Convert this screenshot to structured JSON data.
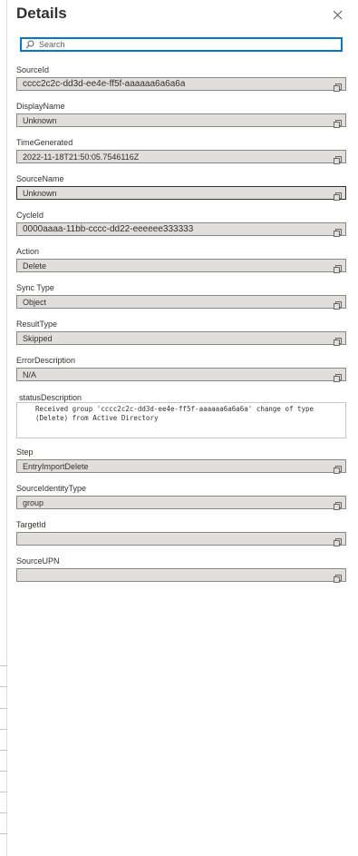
{
  "panel": {
    "title": "Details",
    "close_icon": "close-icon"
  },
  "search": {
    "placeholder": "Search",
    "icon": "search-icon"
  },
  "fields": [
    {
      "label": "SourceId",
      "value": "cccc2c2c-dd3d-ee4e-ff5f-aaaaaa6a6a6a"
    },
    {
      "label": "DisplayName",
      "value": "Unknown"
    },
    {
      "label": "TimeGenerated",
      "value": "2022-11-18T21:50:05.7546116Z"
    },
    {
      "label": "SourceName",
      "value": "Unknown"
    },
    {
      "label": "CycleId",
      "value": "0000aaaa-11bb-cccc-dd22-eeeeee333333"
    },
    {
      "label": "Action",
      "value": "Delete"
    },
    {
      "label": "Sync Type",
      "value": "Object"
    },
    {
      "label": "ResultType",
      "value": "Skipped"
    },
    {
      "label": "ErrorDescription",
      "value": "N/A"
    },
    {
      "label": "Step",
      "value": "EntryImportDelete"
    },
    {
      "label": "SourceIdentityType",
      "value": "group"
    },
    {
      "label": "TargetId",
      "value": ""
    },
    {
      "label": "SourceUPN",
      "value": ""
    }
  ],
  "status_description": {
    "label": "statusDescription",
    "value": "Received group 'cccc2c2c-dd3d-ee4e-ff5f-aaaaaa6a6a6a' change of type (Delete) from Active Directory"
  },
  "icons": {
    "copy": "copy-icon"
  },
  "colors": {
    "accent": "#0078d4",
    "field_bg": "#e1dfdd",
    "field_border": "#8a8886"
  }
}
